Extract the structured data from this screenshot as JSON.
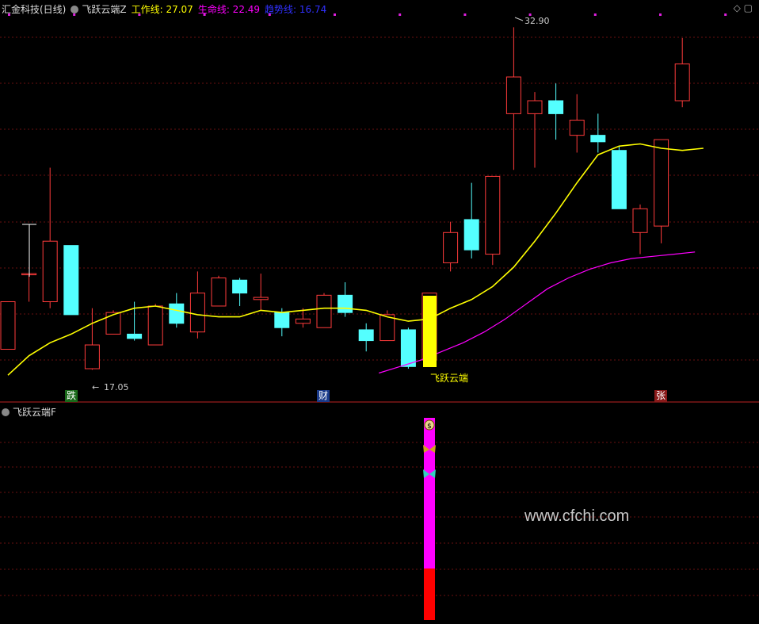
{
  "header_main": {
    "stock": "汇金科技(日线)",
    "indicator": "飞跃云端Z",
    "work_label": "工作线: 27.07",
    "life_label": "生命线: 22.49",
    "trend_label": "趋势线: 16.74",
    "colors": {
      "work": "#ffff00",
      "life": "#ff00ff",
      "trend": "#0000ff"
    }
  },
  "header_sub": {
    "indicator": "飞跃云端F"
  },
  "watermark": "www.cfchi.com",
  "annotations": {
    "high": "32.90",
    "low": "17.05",
    "signal": "飞跃云端"
  },
  "markers": {
    "die": "跌",
    "cai": "财",
    "zhang": "张"
  },
  "chart_data": {
    "type": "candlestick",
    "ylim": [
      16.0,
      33.5
    ],
    "x": [
      1,
      2,
      3,
      4,
      5,
      6,
      7,
      8,
      9,
      10,
      11,
      12,
      13,
      14,
      15,
      16,
      17,
      18,
      19,
      20,
      21,
      22,
      23,
      24,
      25,
      26,
      27,
      28,
      29,
      30,
      31,
      32,
      33
    ],
    "candles": [
      {
        "o": 18.0,
        "c": 20.2,
        "h": 20.2,
        "l": 18.0
      },
      {
        "o": 21.5,
        "c": 21.5,
        "h": 21.5,
        "l": 20.2
      },
      {
        "o": 20.2,
        "c": 23.0,
        "h": 26.4,
        "l": 19.9
      },
      {
        "o": 22.8,
        "c": 19.6,
        "h": 22.8,
        "l": 19.6
      },
      {
        "o": 17.1,
        "c": 18.2,
        "h": 19.9,
        "l": 17.05
      },
      {
        "o": 18.7,
        "c": 19.7,
        "h": 19.8,
        "l": 18.7
      },
      {
        "o": 18.7,
        "c": 18.5,
        "h": 20.2,
        "l": 18.4
      },
      {
        "o": 18.2,
        "c": 20.0,
        "h": 20.1,
        "l": 18.2
      },
      {
        "o": 20.1,
        "c": 19.2,
        "h": 20.6,
        "l": 19.0
      },
      {
        "o": 18.8,
        "c": 20.6,
        "h": 21.6,
        "l": 18.5
      },
      {
        "o": 20.0,
        "c": 21.3,
        "h": 21.4,
        "l": 20.0
      },
      {
        "o": 21.2,
        "c": 20.6,
        "h": 21.3,
        "l": 20.0
      },
      {
        "o": 20.3,
        "c": 20.4,
        "h": 21.5,
        "l": 19.8
      },
      {
        "o": 19.7,
        "c": 19.0,
        "h": 19.9,
        "l": 18.6
      },
      {
        "o": 19.2,
        "c": 19.4,
        "h": 19.9,
        "l": 19.0
      },
      {
        "o": 19.0,
        "c": 20.5,
        "h": 20.6,
        "l": 19.0
      },
      {
        "o": 20.5,
        "c": 19.7,
        "h": 21.1,
        "l": 19.5
      },
      {
        "o": 18.9,
        "c": 18.4,
        "h": 19.2,
        "l": 17.9
      },
      {
        "o": 18.4,
        "c": 19.6,
        "h": 19.8,
        "l": 18.4
      },
      {
        "o": 18.9,
        "c": 17.2,
        "h": 19.0,
        "l": 17.1
      },
      {
        "o": 17.5,
        "c": 20.6,
        "h": 20.6,
        "l": 17.5
      },
      {
        "o": 22.0,
        "c": 23.4,
        "h": 23.9,
        "l": 21.6
      },
      {
        "o": 24.0,
        "c": 22.6,
        "h": 25.7,
        "l": 22.2
      },
      {
        "o": 22.4,
        "c": 26.0,
        "h": 26.0,
        "l": 21.9
      },
      {
        "o": 28.9,
        "c": 30.6,
        "h": 32.9,
        "l": 26.3
      },
      {
        "o": 28.9,
        "c": 29.5,
        "h": 29.9,
        "l": 26.4
      },
      {
        "o": 29.5,
        "c": 28.9,
        "h": 30.3,
        "l": 27.7
      },
      {
        "o": 27.9,
        "c": 28.6,
        "h": 29.8,
        "l": 27.1
      },
      {
        "o": 27.9,
        "c": 27.6,
        "h": 28.9,
        "l": 27.1
      },
      {
        "o": 27.2,
        "c": 24.5,
        "h": 27.4,
        "l": 24.5
      },
      {
        "o": 23.4,
        "c": 24.5,
        "h": 24.7,
        "l": 22.4
      },
      {
        "o": 23.7,
        "c": 27.7,
        "h": 27.7,
        "l": 22.9
      },
      {
        "o": 29.5,
        "c": 31.2,
        "h": 32.4,
        "l": 29.2
      }
    ],
    "work_line": [
      null,
      16.8,
      17.7,
      18.3,
      18.7,
      19.2,
      19.6,
      19.9,
      20.0,
      19.8,
      19.6,
      19.5,
      19.5,
      19.8,
      19.7,
      19.8,
      19.9,
      19.9,
      19.8,
      19.5,
      19.3,
      19.4,
      19.9,
      20.3,
      20.9,
      21.8,
      23.0,
      24.3,
      25.7,
      27.0,
      27.4,
      27.5,
      27.3,
      27.2,
      27.3
    ],
    "life_line_x": [
      18,
      19,
      20,
      21,
      22,
      23,
      24,
      25,
      26,
      27,
      28,
      29,
      30,
      31,
      32,
      33
    ],
    "life_line": [
      16.9,
      17.2,
      17.5,
      17.9,
      18.3,
      18.8,
      19.4,
      20.1,
      20.8,
      21.3,
      21.7,
      22.0,
      22.2,
      22.3,
      22.4,
      22.5
    ]
  },
  "sub_chart": {
    "bar_top_magenta_from": 0.93,
    "bar_red_fraction": 0.28,
    "icons": [
      "money-bag",
      "butterfly-gold",
      "butterfly-cyan"
    ]
  }
}
